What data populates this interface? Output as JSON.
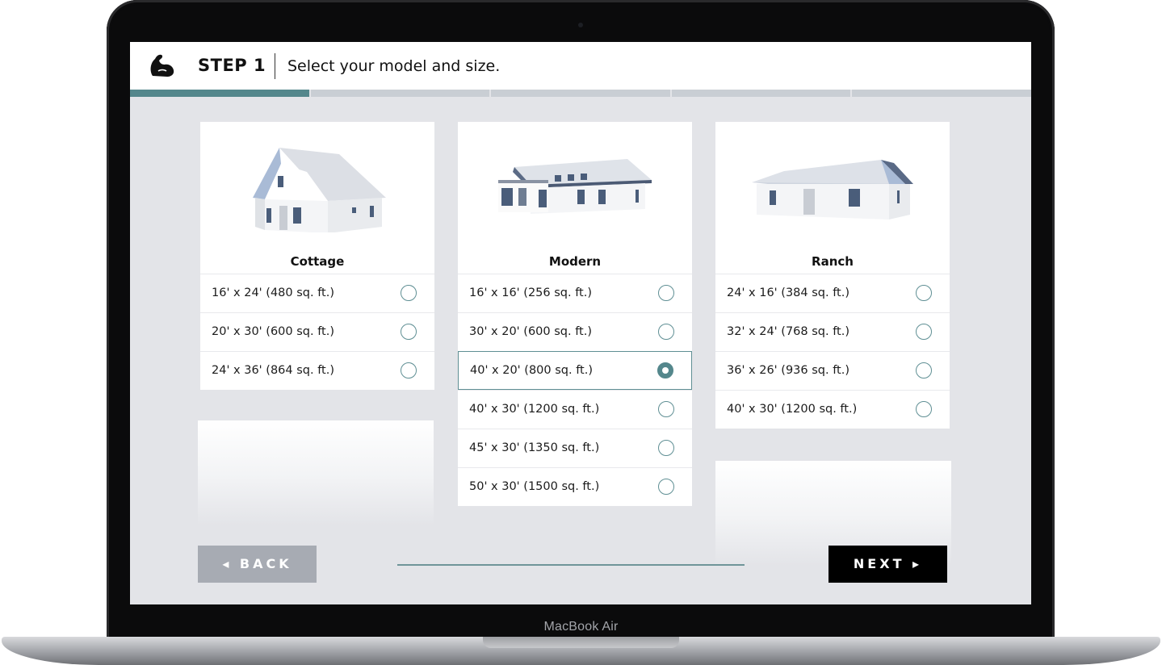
{
  "device": {
    "label": "MacBook Air"
  },
  "header": {
    "step_title": "STEP 1",
    "step_description": "Select your model and size."
  },
  "progress": {
    "segments": 5,
    "active_index": 0
  },
  "colors": {
    "accent": "#54878c",
    "background": "#e3e4e8",
    "next_button": "#000000",
    "back_button": "#a7abb3"
  },
  "models": [
    {
      "name": "Cottage",
      "options": [
        {
          "label": "16' x 24' (480 sq. ft.)",
          "selected": false
        },
        {
          "label": "20' x 30' (600 sq. ft.)",
          "selected": false
        },
        {
          "label": "24' x 36' (864 sq. ft.)",
          "selected": false
        }
      ]
    },
    {
      "name": "Modern",
      "options": [
        {
          "label": "16' x 16' (256 sq. ft.)",
          "selected": false
        },
        {
          "label": "30' x 20' (600 sq. ft.)",
          "selected": false
        },
        {
          "label": "40' x 20' (800 sq. ft.)",
          "selected": true
        },
        {
          "label": "40' x 30' (1200 sq. ft.)",
          "selected": false
        },
        {
          "label": "45' x 30' (1350 sq. ft.)",
          "selected": false
        },
        {
          "label": "50' x 30' (1500 sq. ft.)",
          "selected": false
        }
      ]
    },
    {
      "name": "Ranch",
      "options": [
        {
          "label": "24' x 16' (384 sq. ft.)",
          "selected": false
        },
        {
          "label": "32' x 24' (768 sq. ft.)",
          "selected": false
        },
        {
          "label": "36' x 26' (936 sq. ft.)",
          "selected": false
        },
        {
          "label": "40' x 30' (1200 sq. ft.)",
          "selected": false
        }
      ]
    }
  ],
  "nav": {
    "back_label": "◂ BACK",
    "next_label": "NEXT ▸"
  }
}
